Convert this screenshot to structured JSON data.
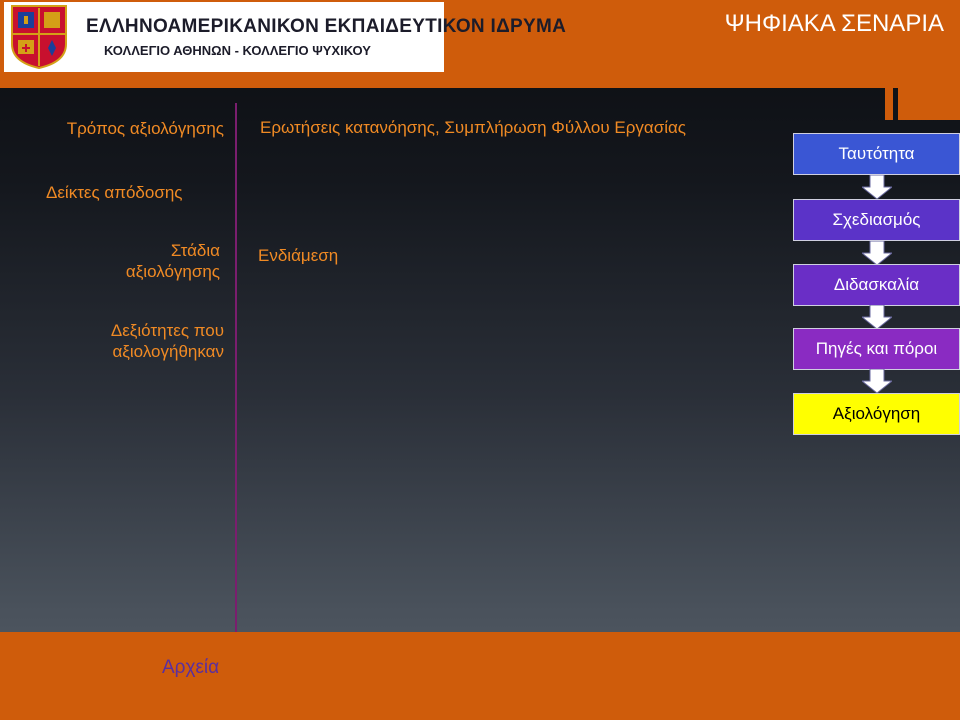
{
  "header": {
    "logo_line1": "ΕΛΛΗΝΟΑΜΕΡΙΚΑΝΙΚΟΝ ΕΚΠΑΙΔΕΥΤΙΚΟΝ ΙΔΡΥΜΑ",
    "logo_line2": "ΚΟΛΛΕΓΙΟ ΑΘΗΝΩΝ - ΚΟΛΛΕΓΙΟ ΨΥΧΙΚΟΥ",
    "title": "ΨΗΦΙΑΚΑ ΣΕΝΑΡΙΑ",
    "crest_icon": "school-crest-icon"
  },
  "left_panel": {
    "assessment_method": "Τρόπος αξιολόγησης",
    "performance_indicators": "Δείκτες απόδοσης",
    "assessment_stages": "Στάδια αξιολόγησης",
    "assessed_skills": "Δεξιότητες που αξιολογήθηκαν"
  },
  "main": {
    "assessment_method_value": "Ερωτήσεις κατανόησης, Συμπλήρωση Φύλλου Εργασίας",
    "assessment_stage_value": "Ενδιάμεση"
  },
  "flow": {
    "items": [
      {
        "label": "Ταυτότητα",
        "color": "#3a56d4"
      },
      {
        "label": "Σχεδιασμός",
        "color": "#5b33c8"
      },
      {
        "label": "Διδασκαλία",
        "color": "#6a2ec6"
      },
      {
        "label": "Πηγές και πόροι",
        "color": "#8a2bc2"
      },
      {
        "label": "Αξιολόγηση",
        "color": "#ffff00"
      }
    ]
  },
  "footer": {
    "files_link": "Αρχεία"
  },
  "colors": {
    "accent": "#cf5c0b",
    "label_orange": "#f08a24",
    "divider": "#7a1e6e"
  }
}
